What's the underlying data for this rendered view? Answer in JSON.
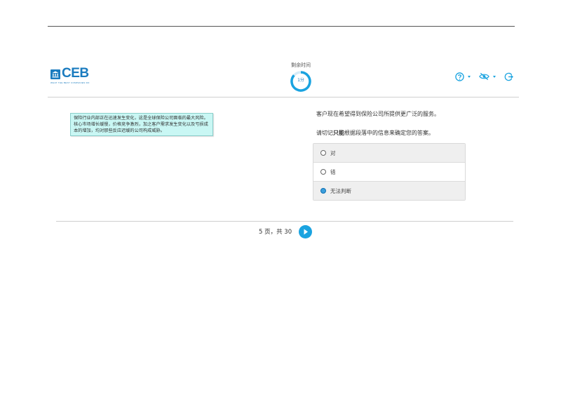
{
  "header": {
    "logo_text": "CEB",
    "logo_tagline": "WHAT THE BEST COMPANIES DO",
    "timer_label": "剩余时间",
    "timer_value": "1分",
    "icons": [
      "help-icon",
      "visibility-off-icon",
      "logout-icon"
    ]
  },
  "passage": {
    "text": "保险行业内部正在迅速发生变化，这是全球保险公司面临的最大风险。核心市场增长缓慢，价格竞争激烈，加之客户需求发生变化以及亏损成本的增加，均对那些反应迟缓的公司构成威胁。"
  },
  "question": {
    "statement": "客户现在希望得到保险公司所提供更广泛的服务。",
    "instruction_prefix": "请切记",
    "instruction_emphasis": "只能",
    "instruction_suffix": "根据段落中的信息来确定您的答案。",
    "options": [
      {
        "label": "对",
        "selected": false
      },
      {
        "label": "错",
        "selected": false
      },
      {
        "label": "无法判断",
        "selected": true
      }
    ]
  },
  "footer": {
    "pagination": "5 页，共 30"
  },
  "colors": {
    "accent": "#1aa3e0",
    "brand": "#1a7bbf",
    "passage_bg": "#c9f7f4"
  }
}
